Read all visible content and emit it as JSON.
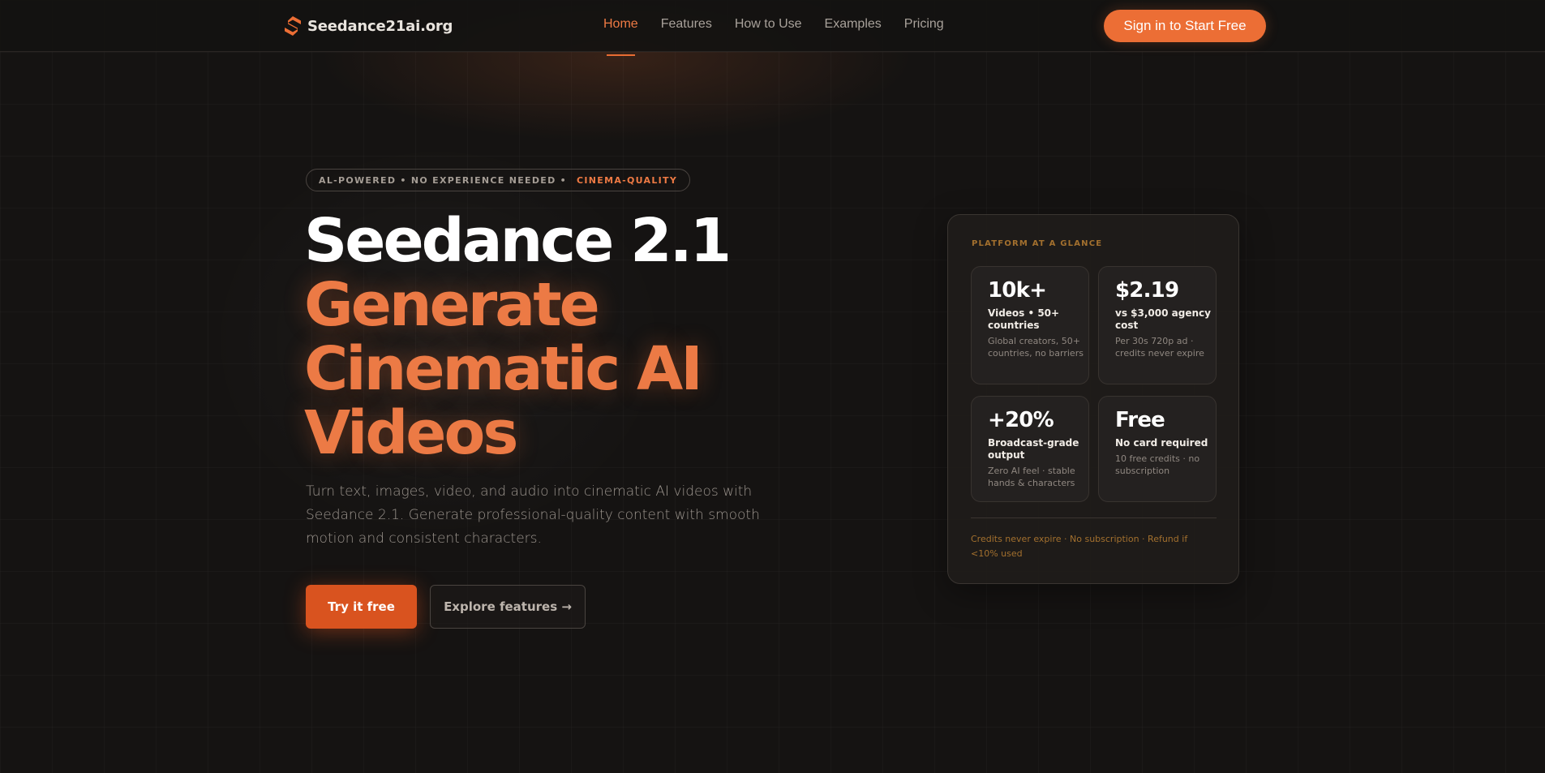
{
  "colors": {
    "background": "#151312",
    "accent": "#ec6e35",
    "accent_text": "#ee7a44",
    "card_label": "#a3702e"
  },
  "nav": {
    "brand_icon": "s-logo-icon",
    "brand_name": "Seedance21ai.org",
    "links": [
      {
        "label": "Home",
        "active": true
      },
      {
        "label": "Features",
        "active": false
      },
      {
        "label": "How to Use",
        "active": false
      },
      {
        "label": "Examples",
        "active": false
      },
      {
        "label": "Pricing",
        "active": false
      }
    ],
    "cta_label": "Sign in to Start Free"
  },
  "hero": {
    "badge_text": "AL-POWERED • NO EXPERIENCE NEEDED •",
    "badge_accent": "CINEMA-QUALITY",
    "title_line1": "Seedance 2.1",
    "title_line2": "Generate",
    "title_line3": "Cinematic AI",
    "title_line4": "Videos",
    "description": "Turn text, images, video, and audio into cinematic AI videos with Seedance 2.1. Generate professional-quality content with smooth motion and consistent characters.",
    "primary_button": "Try it free",
    "secondary_button": "Explore features →"
  },
  "glance": {
    "label": "PLATFORM AT A GLANCE",
    "stats": [
      {
        "value": "10k+",
        "title": "Videos • 50+ countries",
        "subtitle": "Global creators, 50+ countries, no barriers"
      },
      {
        "value": "$2.19",
        "title": "vs $3,000 agency cost",
        "subtitle": "Per 30s 720p ad · credits never expire"
      },
      {
        "value": "+20%",
        "title": "Broadcast-grade output",
        "subtitle": "Zero AI feel · stable hands & characters"
      },
      {
        "value": "Free",
        "title": "No card required",
        "subtitle": "10 free credits · no subscription"
      }
    ],
    "footer": "Credits never expire · No subscription · Refund if <10% used"
  }
}
